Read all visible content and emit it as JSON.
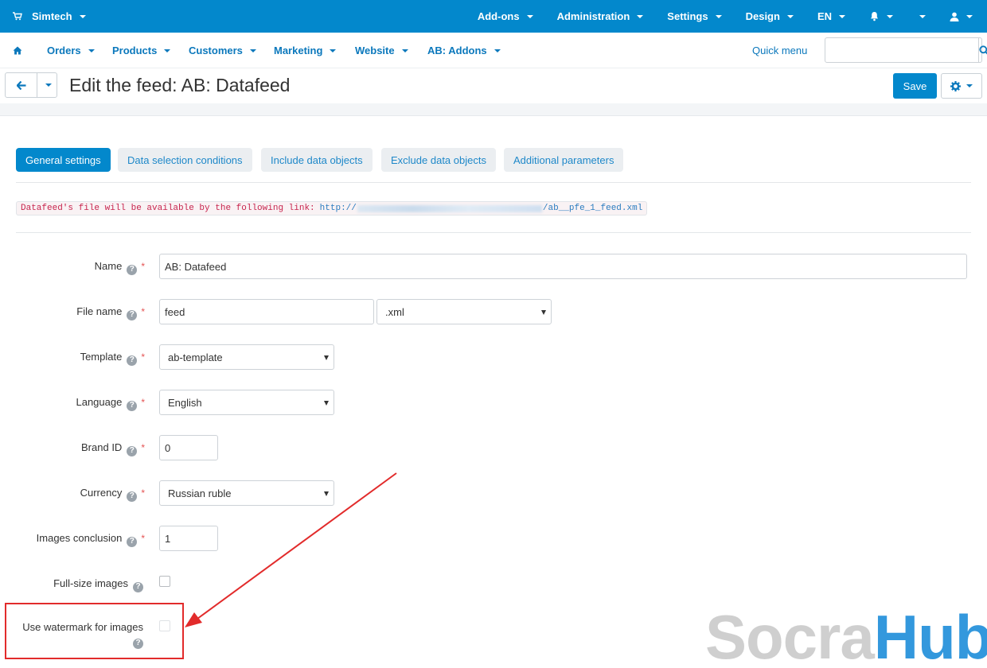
{
  "topbar": {
    "brand": "Simtech",
    "menu": [
      "Add-ons",
      "Administration",
      "Settings",
      "Design",
      "EN"
    ]
  },
  "mainnav": {
    "items": [
      "Orders",
      "Products",
      "Customers",
      "Marketing",
      "Website",
      "AB: Addons"
    ],
    "quick_menu": "Quick menu",
    "search_placeholder": ""
  },
  "header": {
    "title": "Edit the feed: AB: Datafeed",
    "save_label": "Save"
  },
  "tabs": [
    "General settings",
    "Data selection conditions",
    "Include data objects",
    "Exclude data objects",
    "Additional parameters"
  ],
  "notice": {
    "prefix": "Datafeed's file will be available by the following link:",
    "url_start": "http://",
    "url_end": "/ab__pfe_1_feed.xml"
  },
  "form": {
    "name_label": "Name",
    "name_value": "AB: Datafeed",
    "filename_label": "File name",
    "filename_value": "feed",
    "filename_ext": ".xml",
    "template_label": "Template",
    "template_value": "ab-template",
    "language_label": "Language",
    "language_value": "English",
    "brand_label": "Brand ID",
    "brand_value": "0",
    "currency_label": "Currency",
    "currency_value": "Russian ruble",
    "images_label": "Images conclusion",
    "images_value": "1",
    "fullsize_label": "Full-size images",
    "watermark_label": "Use watermark for images",
    "required_mark": "*",
    "help_mark": "?"
  },
  "watermark": {
    "part1": "Socra",
    "part2": "Hub"
  },
  "colors": {
    "primary": "#0388cc",
    "link": "#0b78bc",
    "highlight": "#e22b2b"
  }
}
